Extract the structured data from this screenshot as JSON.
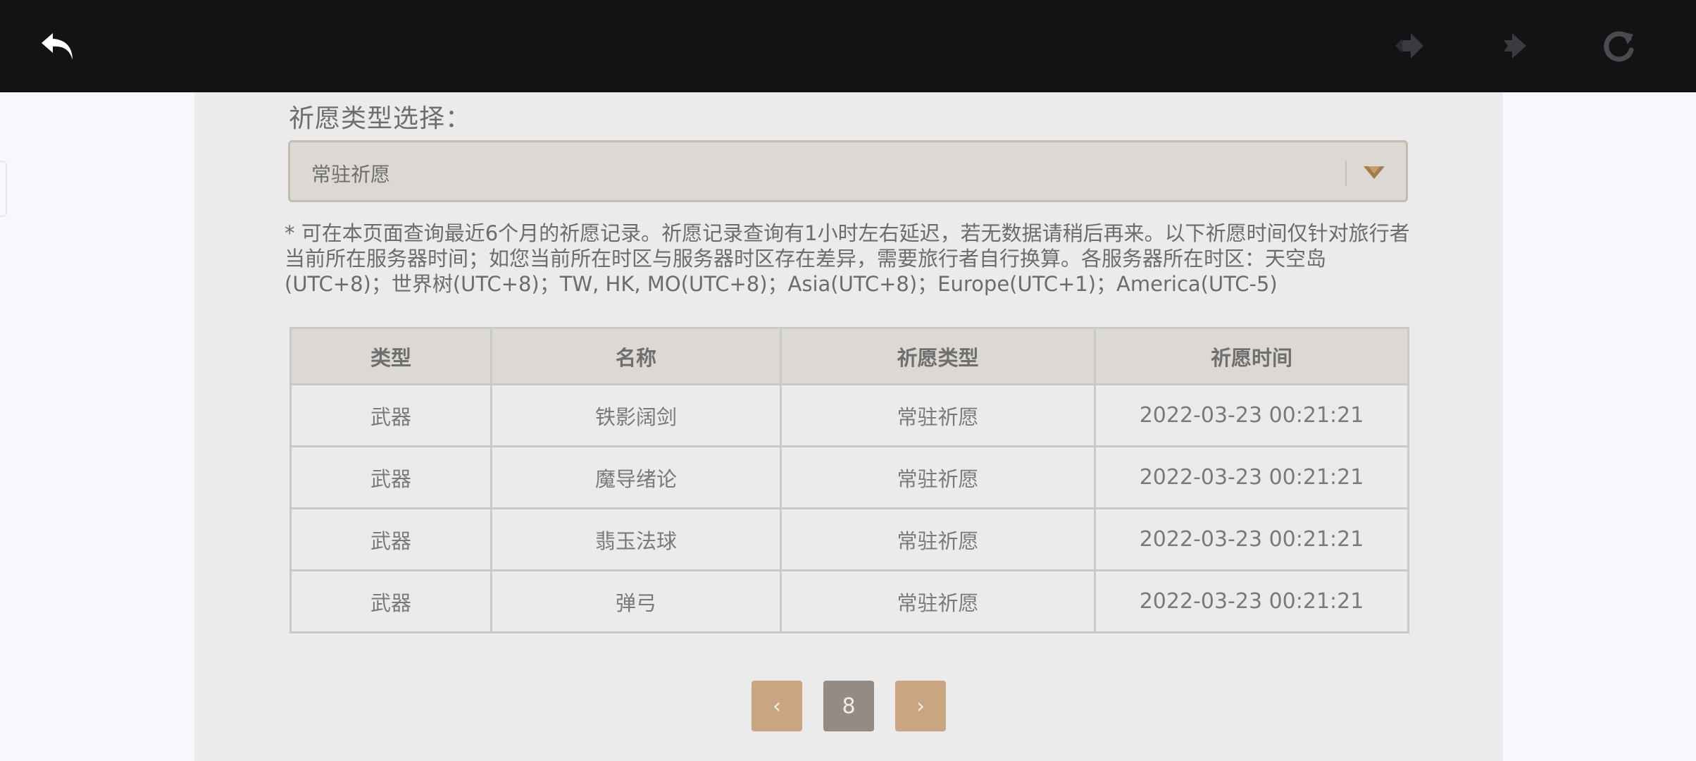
{
  "topbar": {
    "icons": [
      "back-icon",
      "forward-icon",
      "forward-icon",
      "reload-icon"
    ]
  },
  "page": {
    "select_label": "祈愿类型选择：",
    "dropdown_value": "常驻祈愿",
    "notice": "* 可在本页面查询最近6个月的祈愿记录。祈愿记录查询有1小时左右延迟，若无数据请稍后再来。以下祈愿时间仅针对旅行者当前所在服务器时间；如您当前所在时区与服务器时区存在差异，需要旅行者自行换算。各服务器所在时区：天空岛(UTC+8)；世界树(UTC+8)；TW, HK, MO(UTC+8)；Asia(UTC+8)；Europe(UTC+1)；America(UTC-5)"
  },
  "table": {
    "headers": [
      "类型",
      "名称",
      "祈愿类型",
      "祈愿时间"
    ],
    "rows": [
      [
        "武器",
        "铁影阔剑",
        "常驻祈愿",
        "2022-03-23 00:21:21"
      ],
      [
        "武器",
        "魔导绪论",
        "常驻祈愿",
        "2022-03-23 00:21:21"
      ],
      [
        "武器",
        "翡玉法球",
        "常驻祈愿",
        "2022-03-23 00:21:21"
      ],
      [
        "武器",
        "弹弓",
        "常驻祈愿",
        "2022-03-23 00:21:21"
      ]
    ]
  },
  "pager": {
    "prev_label": "‹",
    "current_page": "8",
    "next_label": "›"
  },
  "colors": {
    "topbar": "#121315",
    "panel": "#ebebeb",
    "accent": "#c9a681",
    "current_page": "#948c84"
  }
}
